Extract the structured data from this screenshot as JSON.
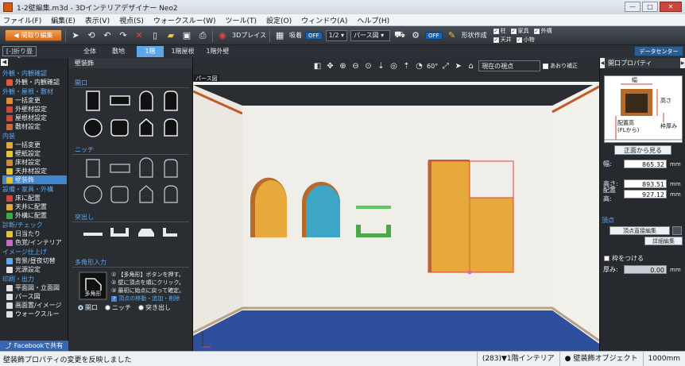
{
  "window": {
    "title": "1-2壁編集.m3d - 3Dインテリアデザイナー Neo2",
    "btn_min": "—",
    "btn_max": "□",
    "btn_close": "✕"
  },
  "menu": [
    "ファイル(F)",
    "編集(E)",
    "表示(V)",
    "視点(S)",
    "ウォークスルー(W)",
    "ツール(T)",
    "設定(O)",
    "ウィンドウ(A)",
    "ヘルプ(H)"
  ],
  "toolbar": {
    "back_label": "間取り編集",
    "view_3d_label": "3Dプレイス",
    "snap_label": "吸着",
    "snap_state": "OFF",
    "scale_value": "1/2",
    "view_mode": "パース図",
    "lock_state": "OFF",
    "shape_create_label": "形状作成",
    "checks": [
      {
        "label": "柱",
        "checked": true
      },
      {
        "label": "家具",
        "checked": true
      },
      {
        "label": "外構",
        "checked": true
      },
      {
        "label": "天井",
        "checked": true
      },
      {
        "label": "小物",
        "checked": true
      }
    ]
  },
  "tabs": {
    "collapse_label": "[-]折り畳む",
    "floors": [
      "全体",
      "敷地",
      "1階",
      "1階屋根",
      "1階外壁"
    ],
    "active_floor": "1階",
    "datacenter_label": "データセンター"
  },
  "leftnav": {
    "sections": [
      {
        "label": "外観・内観確認",
        "items": [
          {
            "label": "外観・内観確認",
            "color": "#e05a3c"
          }
        ]
      },
      {
        "label": "外観・屋根・敷材",
        "items": [
          {
            "label": "一括変更",
            "color": "#e08a3c"
          },
          {
            "label": "外壁材設定",
            "color": "#c9473c"
          },
          {
            "label": "屋根材設定",
            "color": "#c9473c"
          },
          {
            "label": "敷材設定",
            "color": "#c96a3c"
          }
        ]
      },
      {
        "label": "内装",
        "items": [
          {
            "label": "一括変更",
            "color": "#e0a83c"
          },
          {
            "label": "壁紙設定",
            "color": "#e0c43c"
          },
          {
            "label": "床材設定",
            "color": "#c98a3c"
          },
          {
            "label": "天井材設定",
            "color": "#e0c43c"
          },
          {
            "label": "壁装飾",
            "color": "#e0c43c",
            "selected": true
          }
        ]
      },
      {
        "label": "設備・家具・外構",
        "items": [
          {
            "label": "床に配置",
            "color": "#c9473c"
          },
          {
            "label": "天井に配置",
            "color": "#e0a83c"
          },
          {
            "label": "外構に配置",
            "color": "#3ca84a"
          }
        ]
      },
      {
        "label": "診断/チェック",
        "items": [
          {
            "label": "日当たり",
            "color": "#e0c43c"
          },
          {
            "label": "色覚/インテリア",
            "color": "#c96ac9"
          }
        ]
      },
      {
        "label": "イメージ仕上げ",
        "items": [
          {
            "label": "背景/昼夜切替",
            "color": "#5da8f0"
          },
          {
            "label": "光源設定",
            "color": "#e0e0e0"
          }
        ]
      },
      {
        "label": "印刷・出力",
        "items": [
          {
            "label": "平面図・立面図",
            "color": "#e0e0e0"
          },
          {
            "label": "パース図",
            "color": "#e0e0e0"
          },
          {
            "label": "画面置/イメージ",
            "color": "#e0e0e0"
          },
          {
            "label": "ウォークスルー",
            "color": "#e0e0e0"
          }
        ]
      }
    ],
    "facebook_label": "Facebookで共有"
  },
  "palette": {
    "title": "壁装飾",
    "sec_opening": "開口",
    "sec_niche": "ニッチ",
    "sec_protrusion": "突出し",
    "sec_polygon": "多角形入力",
    "polygon_button": "多角形",
    "polygon_steps": [
      "① 【多角形】ボタンを押す。",
      "② 壁に頂点を順にクリック。",
      "③ 最初に始点に戻って確定。"
    ],
    "vertex_help": "頂点の移動・追加・削除",
    "radios": [
      {
        "label": "開口",
        "on": true
      },
      {
        "label": "ニッチ",
        "on": false
      },
      {
        "label": "突き出し",
        "on": false
      }
    ]
  },
  "viewport": {
    "label": "パース図",
    "fov": "60°",
    "viewpoint": "現在の視点",
    "auto_correct": "あおり補正"
  },
  "rightpanel": {
    "title": "開口プロパティ",
    "diagram": {
      "width": "幅",
      "height": "高さ",
      "sill": "配置高",
      "sill_sub": "(FLから)",
      "frame": "枠厚み"
    },
    "front_button": "正面から見る",
    "width_label": "幅:",
    "width_value": "865.32",
    "height_label": "高さ:",
    "height_value": "893.51",
    "sill_label": "配置高:",
    "sill_value": "927.12",
    "unit": "mm",
    "vertex_section": "頂点",
    "vertex_edit": "頂点直接編集",
    "detail_edit": "詳細編集",
    "frame_check": "枠をつける",
    "thickness_label": "厚み:",
    "thickness_value": "0.00"
  },
  "status": {
    "message": "壁装飾プロパティの変更を反映しました",
    "floor_info": "(283)▼1階インテリア",
    "object_info": "壁装飾オブジェクト",
    "grid": "1000mm"
  },
  "colors": {
    "accent": "#3f86cf",
    "orange": "#e8a93c",
    "teal": "#3ca6c4",
    "green": "#5cc95c"
  }
}
